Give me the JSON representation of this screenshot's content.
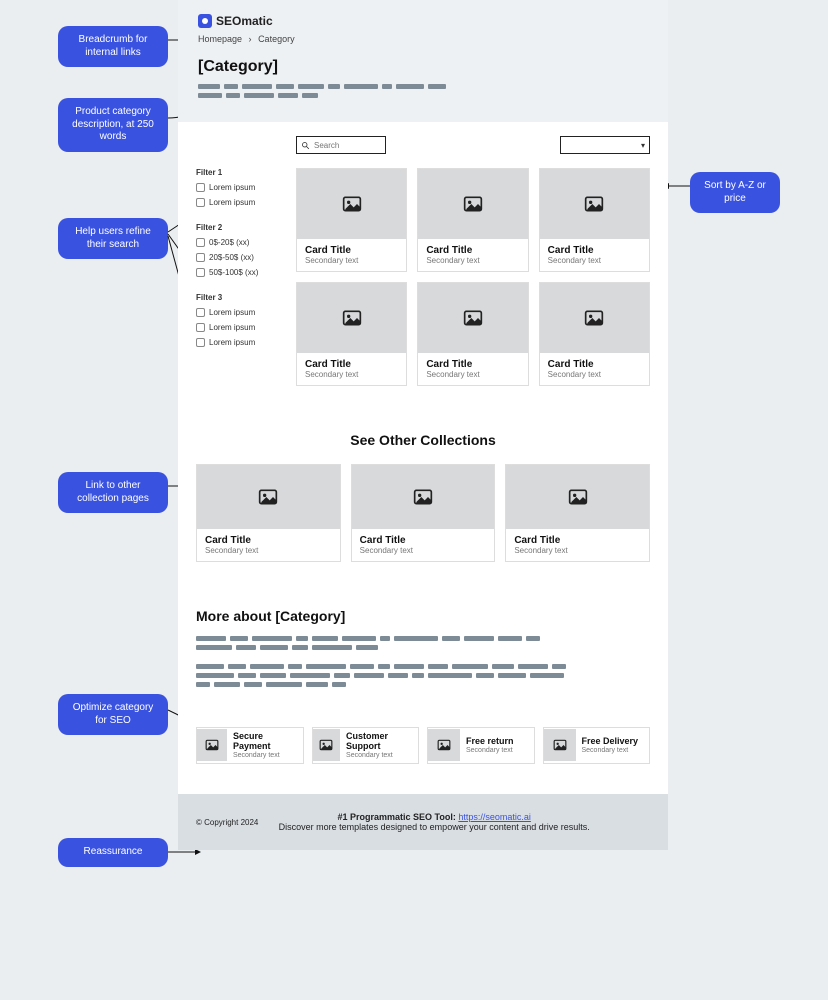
{
  "brand": "SEOmatic",
  "breadcrumb": {
    "home": "Homepage",
    "sep": "›",
    "cat": "Category"
  },
  "hero": {
    "title": "[Category]"
  },
  "search": {
    "placeholder": "Search"
  },
  "filters": {
    "g1": {
      "title": "Filter 1",
      "o1": "Lorem ipsum",
      "o2": "Lorem ipsum"
    },
    "g2": {
      "title": "Filter 2",
      "o1": "0$-20$ (xx)",
      "o2": "20$-50$ (xx)",
      "o3": "50$-100$ (xx)"
    },
    "g3": {
      "title": "Filter 3",
      "o1": "Lorem ipsum",
      "o2": "Lorem ipsum",
      "o3": "Lorem ipsum"
    }
  },
  "card": {
    "title": "Card Title",
    "sub": "Secondary text"
  },
  "collections_title": "See Other Collections",
  "more_title": "More about [Category]",
  "reassure": {
    "r1": {
      "t": "Secure Payment",
      "s": "Secondary text"
    },
    "r2": {
      "t": "Customer Support",
      "s": "Secondary text"
    },
    "r3": {
      "t": "Free return",
      "s": "Secondary text"
    },
    "r4": {
      "t": "Free Delivery",
      "s": "Secondary text"
    }
  },
  "footer": {
    "copy": "© Copyright 2024",
    "line1a": "#1 Programmatic SEO Tool: ",
    "link": "https://seomatic.ai",
    "line2": "Discover more templates designed to empower your content and drive results."
  },
  "annotations": {
    "breadcrumb": "Breadcrumb for internal links",
    "desc": "Product category description, at 250 words",
    "filters": "Help users refine their search",
    "sort": "Sort by A-Z or price",
    "collections": "Link to other collection pages",
    "seo": "Optimize category for SEO",
    "reassure": "Reassurance"
  }
}
